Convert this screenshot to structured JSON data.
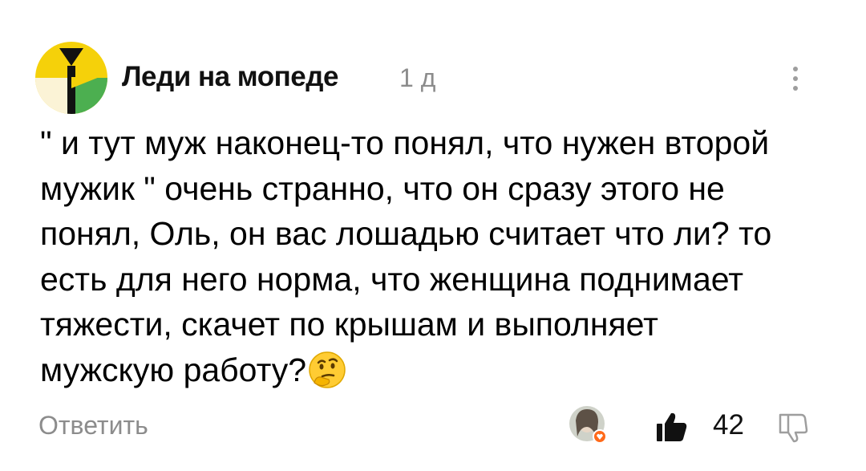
{
  "post": {
    "author": "Леди на мопеде",
    "time_ago": "1 д",
    "more_icon": "vertical-dots-icon",
    "text": "\" и тут муж наконец-то понял, что нужен второй\nмужик \" очень странно, что он сразу этого не\nпонял, Оль, он вас лошадью считает что ли? то\nесть для него норма, что женщина поднимает\nтяжести, скачет по крышам и выполняет\nмужскую работу?",
    "emoji": "thinking-face-emoji",
    "avatar_colors": [
      "#f5d10a",
      "#4caf50",
      "#fbf3d6",
      "#111111"
    ]
  },
  "actions": {
    "reply_label": "Ответить",
    "like_count": "42",
    "like_icon": "thumbs-up-icon",
    "dislike_icon": "thumbs-down-icon",
    "reactor_icon": "reactor-avatar"
  }
}
